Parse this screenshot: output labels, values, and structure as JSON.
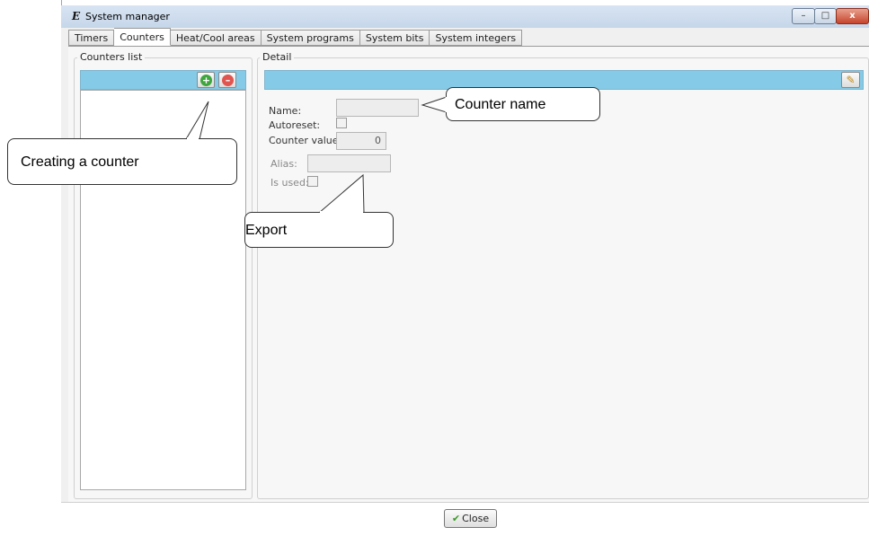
{
  "window": {
    "app_icon": "E",
    "title": "System manager",
    "controls": {
      "minimize": "–",
      "maximize": "□",
      "close": "x"
    }
  },
  "tabs": [
    {
      "label": "Timers",
      "active": false
    },
    {
      "label": "Counters",
      "active": true
    },
    {
      "label": "Heat/Cool areas",
      "active": false
    },
    {
      "label": "System programs",
      "active": false
    },
    {
      "label": "System bits",
      "active": false
    },
    {
      "label": "System integers",
      "active": false
    }
  ],
  "counters_list": {
    "title": "Counters list",
    "add_icon": "+",
    "remove_icon": "–"
  },
  "detail": {
    "title": "Detail",
    "edit_icon": "✎",
    "fields": {
      "name_label": "Name:",
      "autoreset_label": "Autoreset:",
      "counter_value_label": "Counter value:",
      "counter_value": "0",
      "alias_label": "Alias:",
      "is_used_label": "Is used:"
    }
  },
  "footer": {
    "close_label": "Close",
    "close_icon": "✔"
  },
  "callouts": {
    "counter_name": "Counter name",
    "creating": "Creating a counter",
    "export": "Export"
  },
  "colors": {
    "header_blue": "#85cbe7",
    "add_green": "#3fa53f",
    "remove_red": "#e0554f"
  }
}
